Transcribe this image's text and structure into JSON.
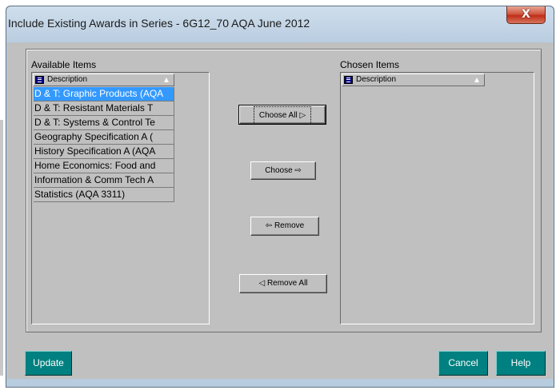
{
  "window": {
    "title": "Include Existing Awards in Series - 6G12_70 AQA June 2012",
    "close_glyph": "X"
  },
  "available": {
    "label": "Available Items",
    "column_header": "Description",
    "items": [
      "D & T: Graphic Products (AQA",
      "D & T: Resistant Materials T",
      "D & T: Systems & Control Te",
      "Geography Specification A (",
      "History Specification A (AQA",
      "Home Economics: Food and",
      "Information & Comm Tech A",
      "Statistics (AQA 3311)"
    ],
    "selected_index": 0
  },
  "chosen": {
    "label": "Chosen Items",
    "column_header": "Description",
    "items": []
  },
  "buttons": {
    "choose_all": "Choose All ▷",
    "choose": "Choose ⇨",
    "remove": "⇦ Remove",
    "remove_all": "◁ Remove All",
    "update": "Update",
    "cancel": "Cancel",
    "help": "Help"
  },
  "colors": {
    "titlebar": "#b9cde0",
    "dialog_face": "#c0c0c0",
    "selection": "#3399ff",
    "action_button": "#008080",
    "close_button": "#c0391f"
  }
}
